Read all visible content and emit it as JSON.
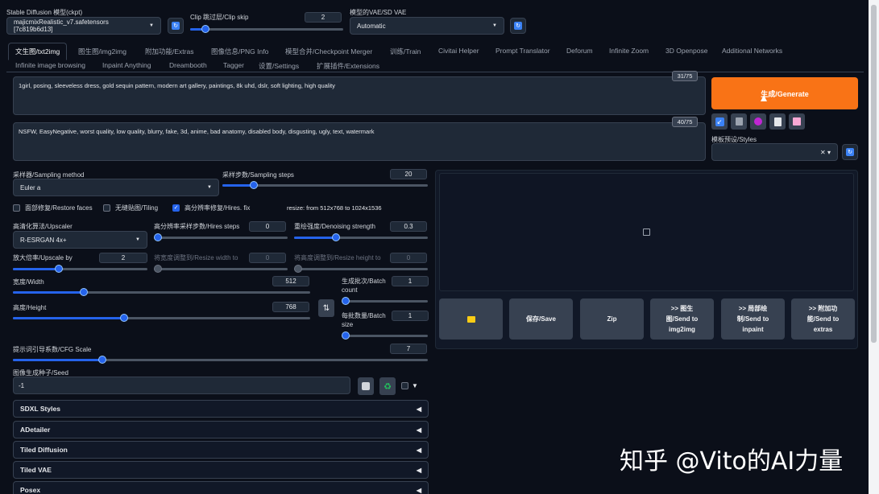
{
  "header": {
    "checkpoint_label": "Stable Diffusion 模型(ckpt)",
    "checkpoint_value": "majicmixRealistic_v7.safetensors [7c819b6d13]",
    "clip_skip_label": "Clip 跳过层/Clip skip",
    "clip_skip_value": "2",
    "clip_skip_fraction": 0.08,
    "vae_label": "模型的VAE/SD VAE",
    "vae_value": "Automatic"
  },
  "tabs_row1": [
    {
      "label": "文生图/txt2img",
      "active": true
    },
    {
      "label": "图生图/img2img"
    },
    {
      "label": "附加功能/Extras"
    },
    {
      "label": "图像信息/PNG Info"
    },
    {
      "label": "模型合并/Checkpoint Merger"
    },
    {
      "label": "训练/Train"
    },
    {
      "label": "Civitai Helper"
    },
    {
      "label": "Prompt Translator"
    },
    {
      "label": "Deforum"
    },
    {
      "label": "Infinite Zoom"
    },
    {
      "label": "3D Openpose"
    },
    {
      "label": "Additional Networks"
    }
  ],
  "tabs_row2": [
    {
      "label": "Infinite image browsing"
    },
    {
      "label": "Inpaint Anything"
    },
    {
      "label": "Dreambooth"
    },
    {
      "label": "Tagger"
    },
    {
      "label": "设置/Settings"
    },
    {
      "label": "扩展插件/Extensions"
    }
  ],
  "prompt": {
    "positive": "1girl, posing, sleeveless dress, gold sequin pattern, modern art gallery, paintings, 8k uhd, dslr, soft lighting, high quality",
    "positive_count": "31/75",
    "negative": "NSFW, EasyNegative, worst quality, low quality, blurry, fake, 3d, anime, bad anatomy, disabled body, disgusting, ugly, text, watermark",
    "negative_count": "40/75"
  },
  "generate_label": "生成/Generate",
  "styles_label": "模板预设/Styles",
  "sampling": {
    "method_label": "采样器/Sampling method",
    "method_value": "Euler a",
    "steps_label": "采样步数/Sampling steps",
    "steps_value": "20",
    "steps_fraction": 0.14
  },
  "checks": {
    "restore_faces": "面部修复/Restore faces",
    "tiling": "无缝贴图/Tiling",
    "hires_fix": "高分辨率修复/Hires. fix",
    "resize_note": "resize: from 512x768 to 1024x1536"
  },
  "hires": {
    "upscaler_label": "高清化算法/Upscaler",
    "upscaler_value": "R-ESRGAN 4x+",
    "steps_label": "高分辨率采样步数/Hires steps",
    "steps_value": "0",
    "steps_fraction": 0.0,
    "denoise_label": "重绘强度/Denoising strength",
    "denoise_value": "0.3",
    "denoise_fraction": 0.3,
    "upscale_by_label": "放大倍率/Upscale by",
    "upscale_by_value": "2",
    "upscale_by_fraction": 0.33,
    "resize_w_label": "将宽度调整到/Resize width to",
    "resize_w_value": "0",
    "resize_h_label": "将高度调整到/Resize height to",
    "resize_h_value": "0"
  },
  "size": {
    "width_label": "宽度/Width",
    "width_value": "512",
    "width_fraction": 0.23,
    "height_label": "高度/Height",
    "height_value": "768",
    "height_fraction": 0.37,
    "batch_count_label": "生成批次/Batch count",
    "batch_count_value": "1",
    "batch_count_fraction": 0.0,
    "batch_size_label": "每批数量/Batch size",
    "batch_size_value": "1",
    "batch_size_fraction": 0.0
  },
  "cfg": {
    "label": "提示词引导系数/CFG Scale",
    "value": "7",
    "fraction": 0.21
  },
  "seed": {
    "label": "图像生成种子/Seed",
    "value": "-1"
  },
  "accordions": [
    "SDXL Styles",
    "ADetailer",
    "Tiled Diffusion",
    "Tiled VAE",
    "Posex"
  ],
  "output_buttons": {
    "folder": "folder-icon",
    "save": "保存/Save",
    "zip": "Zip",
    "img2img": ">> 图生\n图/Send to\nimg2img",
    "inpaint": ">> 局部绘\n制/Send to\ninpaint",
    "extras": ">> 附加功\n能/Send to\nextras"
  },
  "watermark": "知乎 @Vito的AI力量",
  "colors": {
    "generate": "#f97316",
    "accent": "#2563eb",
    "background": "#0b0f19"
  }
}
